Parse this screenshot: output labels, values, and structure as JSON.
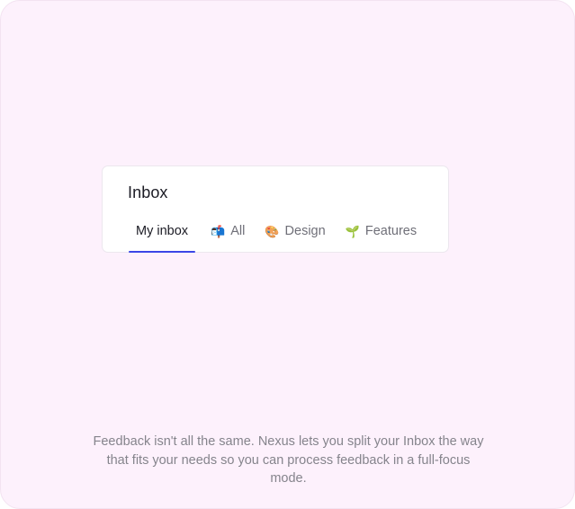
{
  "card": {
    "title": "Inbox",
    "tabs": [
      {
        "label": "My inbox",
        "icon": "",
        "icon_name": "",
        "active": true
      },
      {
        "label": "All",
        "icon": "📬",
        "icon_name": "mailbox-icon",
        "active": false
      },
      {
        "label": "Design",
        "icon": "🎨",
        "icon_name": "palette-icon",
        "active": false
      },
      {
        "label": "Features",
        "icon": "🌱",
        "icon_name": "seedling-icon",
        "active": false
      }
    ]
  },
  "caption": "Feedback isn't all the same. Nexus lets you split your Inbox the way that fits your needs so you can process feedback in a full-focus mode.",
  "colors": {
    "background": "#fdf1fc",
    "active_tab_underline": "#3b46e6",
    "text_primary": "#1b1b24",
    "text_muted": "#6f6f78"
  }
}
